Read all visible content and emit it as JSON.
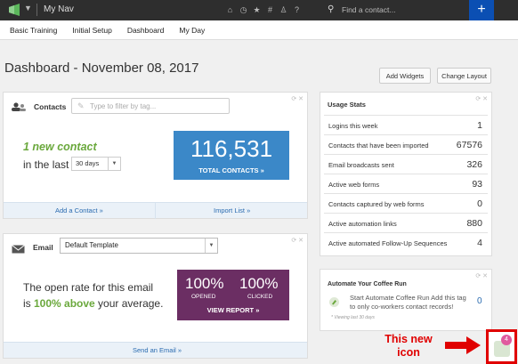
{
  "topbar": {
    "nav_title": "My Nav",
    "icons": [
      "home-icon",
      "clock-icon",
      "star-icon",
      "hashtag-icon",
      "user-icon",
      "help-icon"
    ],
    "search_placeholder": "Find a contact...",
    "plus_label": "+"
  },
  "subnav": {
    "items": [
      "Basic Training",
      "Initial Setup",
      "Dashboard",
      "My Day"
    ]
  },
  "page": {
    "title": "Dashboard - November 08, 2017",
    "add_widgets": "Add Widgets",
    "change_layout": "Change Layout"
  },
  "contacts": {
    "label": "Contacts",
    "tag_placeholder": "Type to filter by tag...",
    "new_contact": "1 new contact",
    "in_the_last": "in the last",
    "days": "30 days",
    "total_value": "116,531",
    "total_label": "TOTAL CONTACTS »",
    "add_contact": "Add a Contact »",
    "import_list": "Import List »"
  },
  "email": {
    "label": "Email",
    "template": "Default Template",
    "rate_line1": "The open rate for this email",
    "rate_is": "is ",
    "rate_above": "100% above",
    "rate_rest": " your average.",
    "opened_value": "100%",
    "opened_label": "OPENED",
    "clicked_value": "100%",
    "clicked_label": "CLICKED",
    "view_report": "VIEW REPORT »",
    "send_email": "Send an Email »"
  },
  "usage": {
    "title": "Usage Stats",
    "rows": [
      {
        "label": "Logins this week",
        "value": "1"
      },
      {
        "label": "Contacts that have been imported",
        "value": "67576"
      },
      {
        "label": "Email broadcasts sent",
        "value": "326"
      },
      {
        "label": "Active web forms",
        "value": "93"
      },
      {
        "label": "Contacts captured by web forms",
        "value": "0"
      },
      {
        "label": "Active automation links",
        "value": "880"
      },
      {
        "label": "Active automated Follow-Up Sequences",
        "value": "4"
      }
    ]
  },
  "coffee": {
    "title": "Automate Your Coffee Run",
    "text": "Start Automate Coffee Run Add this tag to only co-workers contact records!",
    "count": "0",
    "note": "* Viewing last 30 days"
  },
  "annotation": {
    "text": "This new icon",
    "badge": "4"
  },
  "colors": {
    "accent_blue": "#3b88c8",
    "report_purple": "#6b2e63",
    "green": "#6aa83c",
    "annotation_red": "#e00000"
  }
}
